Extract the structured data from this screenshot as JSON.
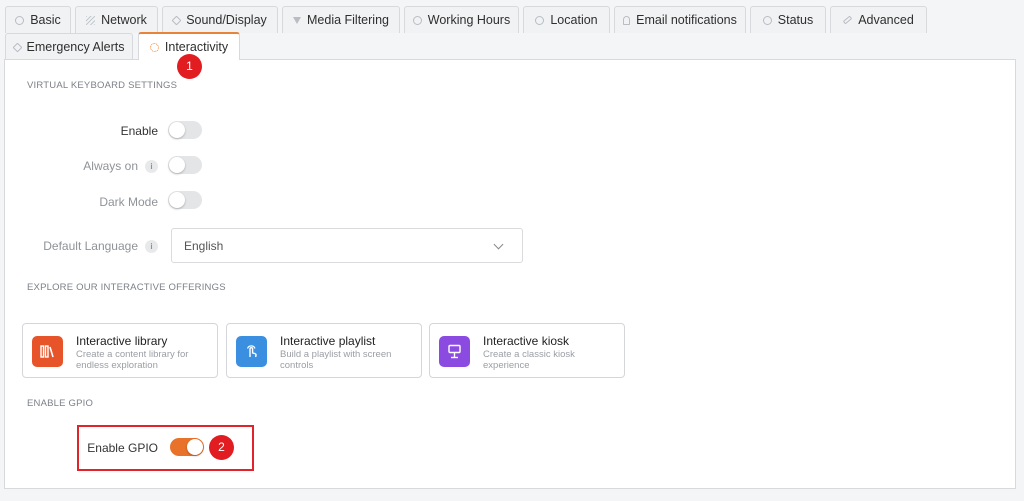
{
  "tabs": {
    "row1": [
      {
        "label": "Basic",
        "icon": "info-icon"
      },
      {
        "label": "Network",
        "icon": "wifi-icon"
      },
      {
        "label": "Sound/Display",
        "icon": "speaker-icon"
      },
      {
        "label": "Media Filtering",
        "icon": "filter-icon"
      },
      {
        "label": "Working Hours",
        "icon": "clock-icon"
      },
      {
        "label": "Location",
        "icon": "compass-icon"
      },
      {
        "label": "Email notifications",
        "icon": "bell-icon"
      },
      {
        "label": "Status",
        "icon": "circle-icon"
      },
      {
        "label": "Advanced",
        "icon": "wrench-icon"
      }
    ],
    "row2": [
      {
        "label": "Emergency Alerts",
        "icon": "alert-icon"
      },
      {
        "label": "Interactivity",
        "icon": "sun-icon",
        "active": true
      }
    ]
  },
  "virtual_keyboard": {
    "title": "VIRTUAL KEYBOARD SETTINGS",
    "enable_label": "Enable",
    "enable_on": false,
    "always_on_label": "Always on",
    "always_on_on": false,
    "dark_mode_label": "Dark Mode",
    "dark_mode_on": false,
    "language_label": "Default Language",
    "language_value": "English"
  },
  "offerings": {
    "title": "EXPLORE OUR INTERACTIVE OFFERINGS",
    "cards": [
      {
        "title": "Interactive library",
        "desc": "Create a content library for endless exploration",
        "color": "#e8542a",
        "icon": "books-icon"
      },
      {
        "title": "Interactive playlist",
        "desc": "Build a playlist with screen controls",
        "color": "#3b8fe0",
        "icon": "touch-icon"
      },
      {
        "title": "Interactive kiosk",
        "desc": "Create a classic kiosk experience",
        "color": "#8b4be0",
        "icon": "kiosk-icon"
      }
    ]
  },
  "gpio": {
    "title": "ENABLE GPIO",
    "label": "Enable GPIO",
    "on": true
  },
  "markers": {
    "first": "1",
    "second": "2"
  },
  "colors": {
    "accent": "#e8722a",
    "marker": "#e11d22"
  }
}
